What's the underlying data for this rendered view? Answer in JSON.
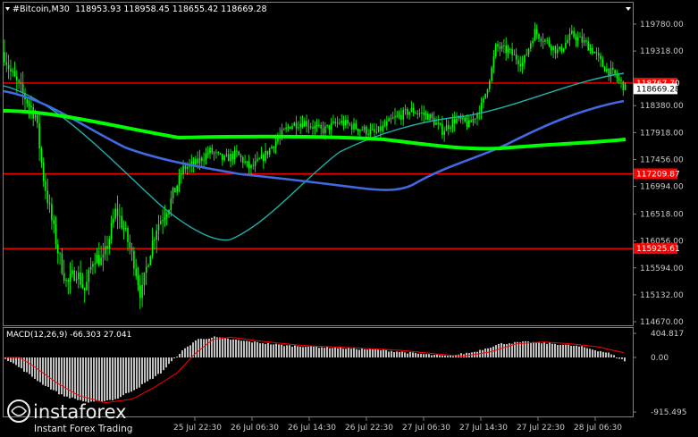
{
  "header": {
    "symbol": "#Bitcoin,M30",
    "ohlc": "118953.93 118958.45 118655.42 118669.28"
  },
  "price_axis": {
    "ticks": [
      "119780.00",
      "119318.00",
      "118380.00",
      "117918.00",
      "117456.00",
      "116994.00",
      "116518.00",
      "116056.00",
      "115594.00",
      "115132.00",
      "114670.00"
    ],
    "min": 114670,
    "max": 119780
  },
  "levels": [
    {
      "label": "118767.70",
      "price": 118767.7,
      "color": "#ff0000"
    },
    {
      "label": "117209.87",
      "price": 117209.87,
      "color": "#ff0000"
    },
    {
      "label": "115925.61",
      "price": 115925.61,
      "color": "#ff0000"
    }
  ],
  "current_price": {
    "label": "118669.28",
    "price": 118669.28
  },
  "time_axis": [
    "25 Jul 22:30",
    "26 Jul 06:30",
    "26 Jul 14:30",
    "26 Jul 22:30",
    "27 Jul 06:30",
    "27 Jul 14:30",
    "27 Jul 22:30",
    "28 Jul 06:30"
  ],
  "macd": {
    "label": "MACD(12,26,9) -66.303 27.041",
    "ticks": [
      "404.817",
      "0.00",
      "-915.495"
    ],
    "max": 404.817,
    "min": -915.495
  },
  "watermark": {
    "brand": "instaforex",
    "tagline": "Instant Forex Trading"
  },
  "colors": {
    "background": "#000000",
    "candles": "#00ff00",
    "ma_slow": "#00ff00",
    "ma_mid": "#4169e1",
    "ma_fast": "#20b2aa",
    "level_line": "#ff0000",
    "macd_hist": "#c0c0c0",
    "macd_signal": "#ff0000"
  },
  "chart_data": {
    "type": "line",
    "x": [
      "25 Jul 22:30",
      "26 Jul 06:30",
      "26 Jul 14:30",
      "26 Jul 22:30",
      "27 Jul 06:30",
      "27 Jul 14:30",
      "27 Jul 22:30",
      "28 Jul 06:30"
    ],
    "series": [
      {
        "values": [
          117400,
          117530,
          117370,
          117800,
          118050,
          118000,
          119400,
          118670
        ]
      },
      {
        "values": [
          117680,
          117780,
          117730,
          117750,
          117750,
          117760,
          117800,
          118200
        ]
      },
      {
        "values": [
          116050,
          117300,
          117550,
          118050,
          118300,
          118450,
          118700,
          118900
        ]
      },
      {
        "values": [
          117700,
          117640,
          117550,
          117280,
          117490,
          117600,
          117820,
          117890
        ]
      }
    ],
    "ylim": [
      114670,
      119780
    ]
  }
}
